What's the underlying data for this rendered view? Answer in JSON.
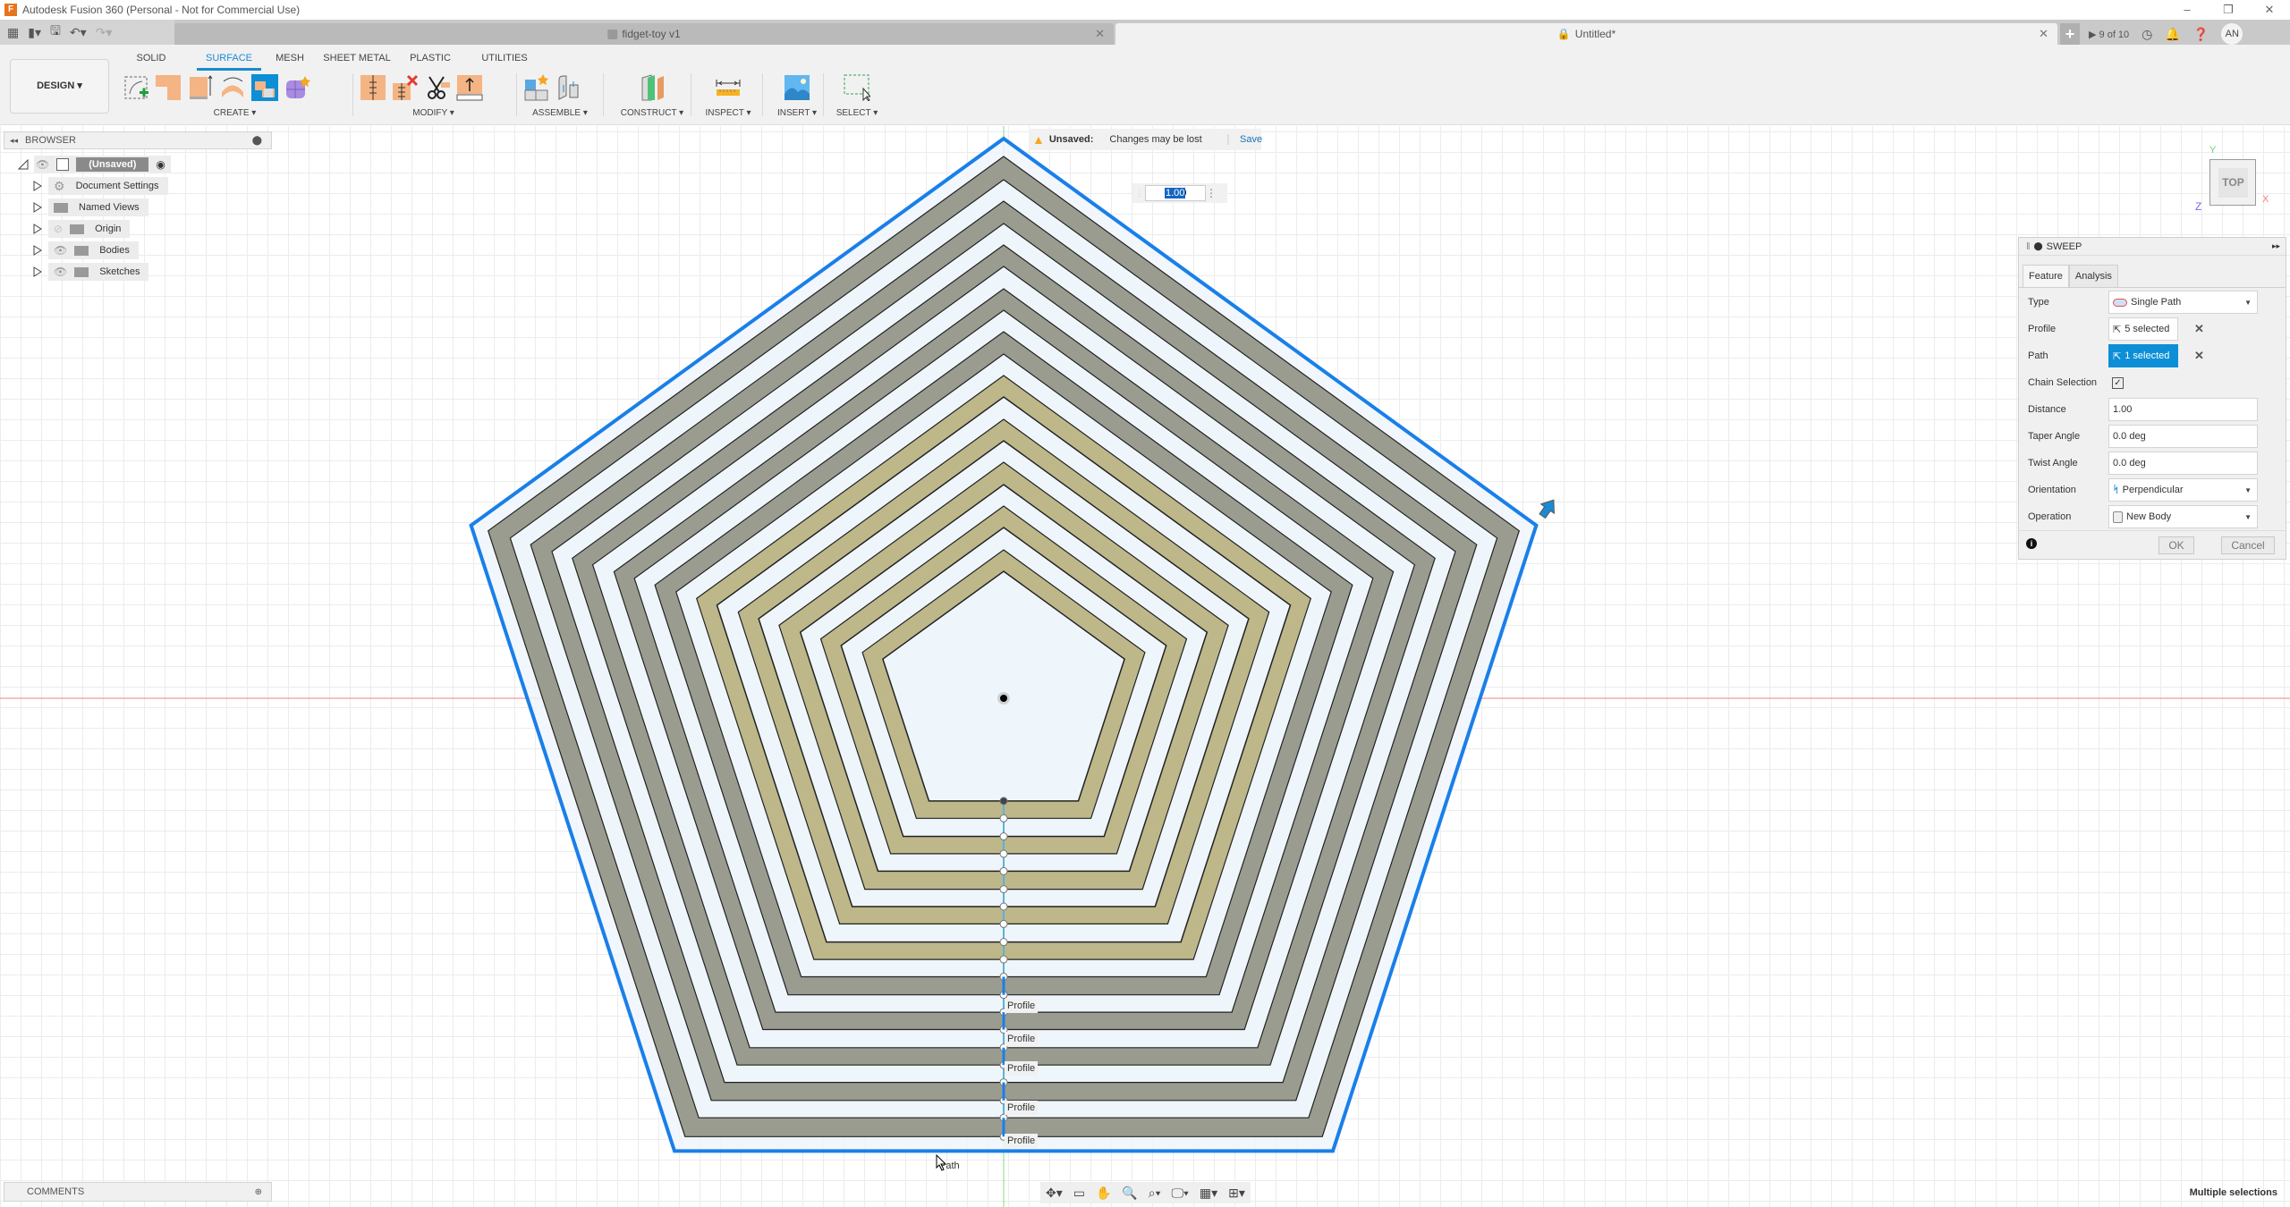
{
  "app": {
    "title": "Autodesk Fusion 360 (Personal - Not for Commercial Use)",
    "window_controls": [
      "minimize",
      "restore",
      "close"
    ]
  },
  "tabs": [
    {
      "label": "fidget-toy v1",
      "active": false,
      "icon": "cube-icon"
    },
    {
      "label": "Untitled*",
      "active": true,
      "icon": "lock-icon"
    }
  ],
  "top_right": {
    "jobs_label": "9 of 10",
    "avatar_initials": "AN"
  },
  "toolbar": {
    "workspace_label": "DESIGN",
    "workspace_tabs": [
      "SOLID",
      "SURFACE",
      "MESH",
      "SHEET METAL",
      "PLASTIC",
      "UTILITIES"
    ],
    "active_workspace_tab": "SURFACE",
    "groups": [
      {
        "label": "CREATE",
        "tools": [
          "create-sketch",
          "extrude",
          "extrude-surface",
          "revolve",
          "sweep",
          "create-form"
        ]
      },
      {
        "label": "MODIFY",
        "tools": [
          "stitch",
          "unstitch",
          "trim",
          "offset"
        ]
      },
      {
        "label": "ASSEMBLE",
        "tools": [
          "new-component",
          "joint"
        ]
      },
      {
        "label": "CONSTRUCT",
        "tools": [
          "offset-plane"
        ]
      },
      {
        "label": "INSPECT",
        "tools": [
          "measure"
        ]
      },
      {
        "label": "INSERT",
        "tools": [
          "insert-image"
        ]
      },
      {
        "label": "SELECT",
        "tools": [
          "window-select"
        ]
      }
    ]
  },
  "browser": {
    "title": "BROWSER",
    "root": "(Unsaved)",
    "items": [
      {
        "label": "Document Settings",
        "icon": "gear-icon",
        "visible": null
      },
      {
        "label": "Named Views",
        "icon": "folder-icon",
        "visible": null
      },
      {
        "label": "Origin",
        "icon": "folder-icon",
        "visible": false
      },
      {
        "label": "Bodies",
        "icon": "folder-icon",
        "visible": true
      },
      {
        "label": "Sketches",
        "icon": "folder-icon",
        "visible": true
      }
    ]
  },
  "unsaved_banner": {
    "label": "Unsaved:",
    "message": "Changes may be lost",
    "action": "Save"
  },
  "distance_input": {
    "value": "1.00"
  },
  "viewcube": {
    "face": "TOP",
    "axes": [
      "Y",
      "X",
      "Z"
    ]
  },
  "sweep_dialog": {
    "title": "SWEEP",
    "tabs": [
      "Feature",
      "Analysis"
    ],
    "active_tab": "Feature",
    "fields": {
      "type": {
        "label": "Type",
        "value": "Single Path"
      },
      "profile": {
        "label": "Profile",
        "value": "5 selected"
      },
      "path": {
        "label": "Path",
        "value": "1 selected"
      },
      "chain_selection": {
        "label": "Chain Selection",
        "checked": true
      },
      "distance": {
        "label": "Distance",
        "value": "1.00"
      },
      "taper_angle": {
        "label": "Taper Angle",
        "value": "0.0 deg"
      },
      "twist_angle": {
        "label": "Twist Angle",
        "value": "0.0 deg"
      },
      "orientation": {
        "label": "Orientation",
        "value": "Perpendicular"
      },
      "operation": {
        "label": "Operation",
        "value": "New Body"
      }
    },
    "ok_label": "OK",
    "cancel_label": "Cancel"
  },
  "canvas": {
    "profile_labels": [
      "Profile",
      "Profile",
      "Profile",
      "Profile",
      "Profile"
    ],
    "cursor_tooltip": "Path",
    "colors": {
      "path_highlight": "#1a7fe8",
      "outer_band": "#9b9c90",
      "inner_band": "#bdb78a",
      "region_fill": "#eef6fc",
      "x_axis": "#f08080",
      "y_axis": "#7fe07f"
    }
  },
  "comments": {
    "title": "COMMENTS"
  },
  "nav_bar": {
    "tools": [
      "orbit",
      "look-at",
      "pan",
      "zoom",
      "fit",
      "display-settings",
      "grid-settings",
      "viewports"
    ]
  },
  "status": {
    "text": "Multiple selections"
  }
}
